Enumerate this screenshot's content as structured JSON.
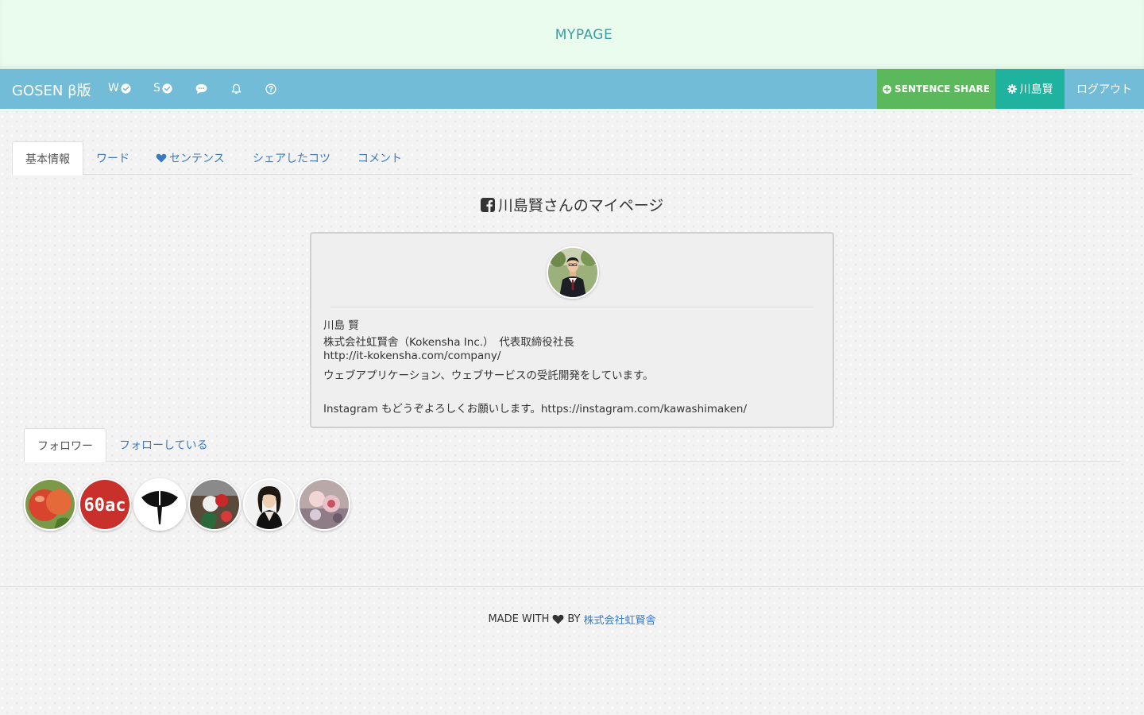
{
  "banner": {
    "title": "MYPAGE"
  },
  "navbar": {
    "brand": "GOSEN β版",
    "items": [
      {
        "label": "W",
        "icon": "check-circle-icon"
      },
      {
        "label": "S",
        "icon": "check-circle-icon"
      },
      {
        "label": "",
        "icon": "comment-icon"
      },
      {
        "label": "",
        "icon": "bell-icon"
      },
      {
        "label": "",
        "icon": "question-circle-icon"
      }
    ],
    "share_label": "SENTENCE SHARE",
    "user_label": "川島賢",
    "logout_label": "ログアウト"
  },
  "tabs": [
    {
      "label": "基本情報",
      "active": true
    },
    {
      "label": "ワード"
    },
    {
      "label": "センテンス",
      "icon": "heart-icon"
    },
    {
      "label": "シェアしたコツ"
    },
    {
      "label": "コメント"
    }
  ],
  "heading": {
    "text": "川島賢さんのマイページ",
    "icon": "facebook-square-icon"
  },
  "profile": {
    "bio": [
      "川島 賢",
      "株式会社虹賢舎（Kokensha Inc.）　代表取締役社長",
      "http://it-kokensha.com/company/",
      "ウェブアプリケーション、ウェブサービスの受託開発をしています。",
      "",
      "Instagram もどうぞよろしくお願いします。https://instagram.com/kawashimaken/"
    ]
  },
  "follow_tabs": [
    {
      "label": "フォロワー",
      "active": true
    },
    {
      "label": "フォローしている"
    }
  ],
  "followers": [
    {
      "kind": "apple-photo"
    },
    {
      "kind": "text-logo",
      "text": "60ac",
      "color": "#c9302c"
    },
    {
      "kind": "ginkgo-logo"
    },
    {
      "kind": "flower-photo"
    },
    {
      "kind": "woman-photo"
    },
    {
      "kind": "sweets-photo"
    }
  ],
  "footer": {
    "made_with": "MADE WITH",
    "by": "BY",
    "company": "株式会社虹賢舎"
  }
}
